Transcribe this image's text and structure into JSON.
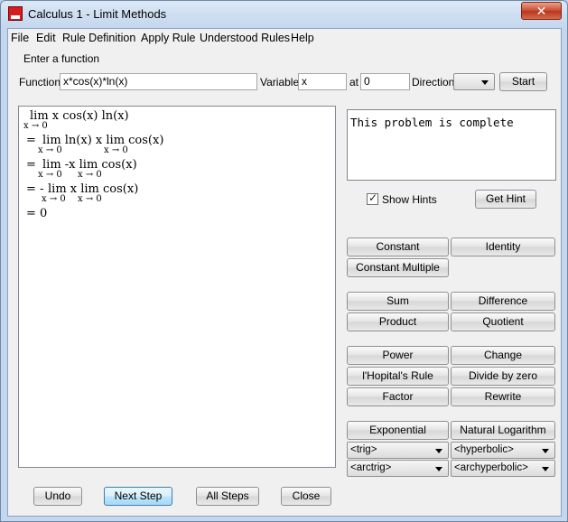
{
  "window": {
    "title": "Calculus 1 - Limit Methods",
    "close_glyph": "✕"
  },
  "menu": [
    "File",
    "Edit",
    "Rule Definition",
    "Apply Rule",
    "Understood Rules",
    "Help"
  ],
  "input": {
    "group_label": "Enter a function",
    "function_label": "Function",
    "function_value": "x*cos(x)*ln(x)",
    "variable_label": "Variable",
    "variable_value": "x",
    "at_label": "at",
    "at_value": "0",
    "direction_label": "Direction",
    "direction_value": "",
    "start_label": "Start"
  },
  "steps": [
    {
      "prefix": "",
      "expr": "lim  x cos(x) ln(x)",
      "subs": [
        "x → 0"
      ]
    },
    {
      "prefix": "=",
      "expr": "lim  ln(x) x  lim  cos(x)",
      "subs": [
        "x → 0",
        "x → 0"
      ]
    },
    {
      "prefix": "=",
      "expr": "lim  -x  lim  cos(x)",
      "subs": [
        "x → 0",
        "x → 0"
      ]
    },
    {
      "prefix": "= -",
      "expr": "lim  x  lim  cos(x)",
      "subs": [
        "x → 0",
        "x → 0"
      ]
    },
    {
      "prefix": "= 0",
      "expr": "",
      "subs": []
    }
  ],
  "status": {
    "message": "This problem is complete"
  },
  "hints": {
    "show_hints_label": "Show Hints",
    "show_hints_checked": true,
    "get_hint_label": "Get Hint"
  },
  "rules": {
    "group1": [
      "Constant",
      "Identity",
      "Constant Multiple"
    ],
    "group2": [
      "Sum",
      "Difference",
      "Product",
      "Quotient"
    ],
    "group3": [
      "Power",
      "Change",
      "l'Hopital's Rule",
      "Divide by zero",
      "Factor",
      "Rewrite"
    ],
    "group4": [
      "Exponential",
      "Natural Logarithm"
    ],
    "dropdowns": [
      "<trig>",
      "<hyperbolic>",
      "<arctrig>",
      "<archyperbolic>"
    ]
  },
  "bottom_buttons": [
    "Undo",
    "Next Step",
    "All Steps",
    "Close"
  ]
}
